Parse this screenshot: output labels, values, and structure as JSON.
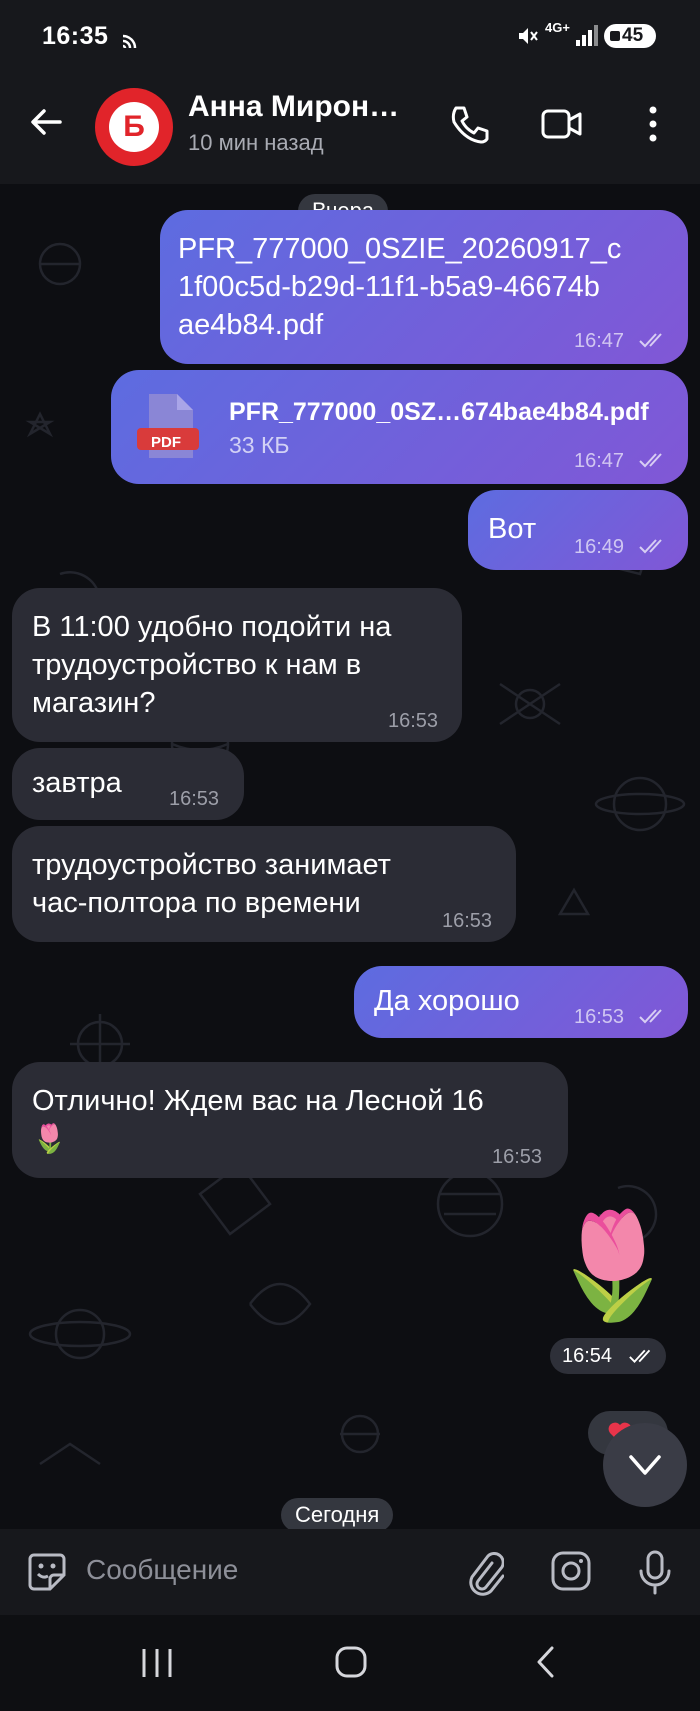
{
  "status_bar": {
    "time": "16:35",
    "network": "4G+",
    "battery": "45",
    "icons": [
      "cast-icon",
      "mute-icon",
      "signal-icon",
      "battery-icon"
    ]
  },
  "header": {
    "avatar_letter": "Б",
    "avatar_color": "#e1242a",
    "contact_name": "Анна Мирон…",
    "last_seen": "10 мин назад",
    "icons": [
      "back-arrow-icon",
      "phone-icon",
      "video-call-icon",
      "more-vertical-icon"
    ]
  },
  "chat": {
    "date_yesterday": "Вчера",
    "date_today": "Сегодня",
    "messages": [
      {
        "dir": "out",
        "text": "PFR_777000_0SZIE_20260917_c1f00c5d-b29d-11f1-b5a9-46674bae4b84.pdf",
        "lines": [
          "PFR_777000_0SZIE_20260917_c",
          "1f00c5d-b29d-11f1-b5a9-46674b",
          "ae4b84.pdf"
        ],
        "time": "16:47"
      },
      {
        "dir": "out",
        "type": "file",
        "file_label": "PDF",
        "file_name": "PFR_777000_0SZ…674bae4b84.pdf",
        "file_size": "33 КБ",
        "time": "16:47"
      },
      {
        "dir": "out",
        "text": "Вот",
        "time": "16:49"
      },
      {
        "dir": "in",
        "lines": [
          "В 11:00 удобно подойти на",
          "трудоустройство к нам в",
          "магазин?"
        ],
        "time": "16:53"
      },
      {
        "dir": "in",
        "text": "завтра",
        "time": "16:53"
      },
      {
        "dir": "in",
        "lines": [
          "трудоустройство занимает",
          "час-полтора по времени"
        ],
        "time": "16:53"
      },
      {
        "dir": "out",
        "text": "Да хорошо",
        "time": "16:53"
      },
      {
        "dir": "in",
        "lines": [
          "Отлично! Ждем вас на Лесной 16",
          "🌷"
        ],
        "time": "16:53"
      },
      {
        "dir": "out",
        "type": "sticker",
        "sticker": "🌷",
        "time": "16:54"
      }
    ],
    "accent_gradient": [
      "#5d6ce0",
      "#8157d6"
    ],
    "incoming_color": "#2b2c35"
  },
  "input_bar": {
    "placeholder": "Сообщение",
    "icons": [
      "sticker-icon",
      "attach-icon",
      "camera-icon",
      "microphone-icon"
    ]
  },
  "nav_bar": {
    "icons": [
      "recents-icon",
      "home-icon",
      "back-icon"
    ]
  },
  "scroll_down_icon": "chevron-down-icon",
  "reaction_icon": "heart-icon"
}
